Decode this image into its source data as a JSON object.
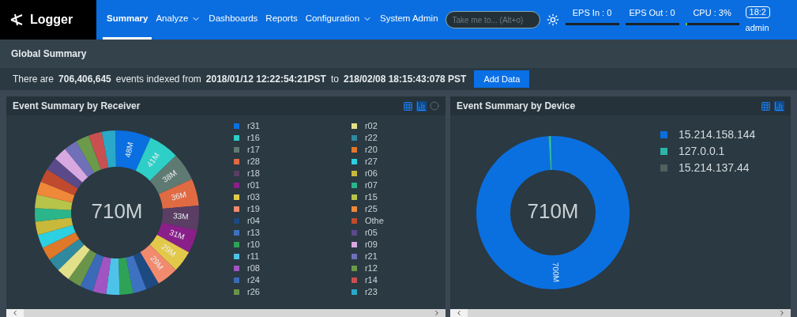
{
  "app": {
    "name": "Logger"
  },
  "nav": [
    {
      "label": "Summary",
      "selected": true,
      "dropdown": false
    },
    {
      "label": "Analyze",
      "selected": false,
      "dropdown": true
    },
    {
      "label": "Dashboards",
      "selected": false,
      "dropdown": false
    },
    {
      "label": "Reports",
      "selected": false,
      "dropdown": false
    },
    {
      "label": "Configuration",
      "selected": false,
      "dropdown": true
    },
    {
      "label": "System Admin",
      "selected": false,
      "dropdown": false
    }
  ],
  "search": {
    "placeholder": "Take me to... (Alt+o)"
  },
  "stats": [
    {
      "label": "EPS In : 0"
    },
    {
      "label": "EPS Out : 0"
    },
    {
      "label": "CPU : 3%",
      "level": 0.03
    }
  ],
  "clock": "18:2",
  "user": "admin",
  "global_summary": {
    "title": "Global Summary",
    "prefix": "There are",
    "count": "706,406,645",
    "middle": "events indexed from",
    "from": "2018/01/12 12:22:54:21PST",
    "to_word": "to",
    "to": "218/02/08 18:15:43:078 PST",
    "button": "Add Data"
  },
  "receiver_panel": {
    "title": "Event Summary by Receiver",
    "total": "710M",
    "slice_labels": [
      "48M",
      "41M",
      "38M",
      "36M",
      "33M",
      "31M",
      "29M",
      "29M"
    ],
    "legend": [
      {
        "label": "r31",
        "color": "#0a6fe0"
      },
      {
        "label": "r16",
        "color": "#2ecfc7"
      },
      {
        "label": "r17",
        "color": "#5f7a72"
      },
      {
        "label": "r28",
        "color": "#e06b43"
      },
      {
        "label": "r18",
        "color": "#5a3e63"
      },
      {
        "label": "r01",
        "color": "#8a1f8a"
      },
      {
        "label": "r03",
        "color": "#e3c94a"
      },
      {
        "label": "r19",
        "color": "#f28a6e"
      },
      {
        "label": "r04",
        "color": "#1e4a82"
      },
      {
        "label": "r13",
        "color": "#3d72c2"
      },
      {
        "label": "r10",
        "color": "#2ea357"
      },
      {
        "label": "r11",
        "color": "#4ec3ea"
      },
      {
        "label": "r08",
        "color": "#a055c2"
      },
      {
        "label": "r24",
        "color": "#3a6ab8"
      },
      {
        "label": "r26",
        "color": "#6a944a"
      },
      {
        "label": "r02",
        "color": "#e3e08a"
      },
      {
        "label": "r22",
        "color": "#2f8aa0"
      },
      {
        "label": "r20",
        "color": "#e0782a"
      },
      {
        "label": "r27",
        "color": "#2dd0e0"
      },
      {
        "label": "r06",
        "color": "#c9b93a"
      },
      {
        "label": "r07",
        "color": "#2bb58a"
      },
      {
        "label": "r15",
        "color": "#b7c44a"
      },
      {
        "label": "r25",
        "color": "#f0883a"
      },
      {
        "label": "Othe",
        "color": "#c04a2e"
      },
      {
        "label": "r05",
        "color": "#5a4a8a"
      },
      {
        "label": "r09",
        "color": "#d8a8e0"
      },
      {
        "label": "r21",
        "color": "#7070b8"
      },
      {
        "label": "r12",
        "color": "#6a9a4a"
      },
      {
        "label": "r14",
        "color": "#c85050"
      },
      {
        "label": "r23",
        "color": "#2aa8c8"
      }
    ]
  },
  "device_panel": {
    "title": "Event Summary by Device",
    "total": "710M",
    "slice_labels": [
      "700M"
    ],
    "legend": [
      {
        "label": "15.214.158.144",
        "color": "#0a70e0"
      },
      {
        "label": "127.0.0.1",
        "color": "#2bb5a8"
      },
      {
        "label": "15.214.137.44",
        "color": "#4f615f"
      }
    ]
  }
}
